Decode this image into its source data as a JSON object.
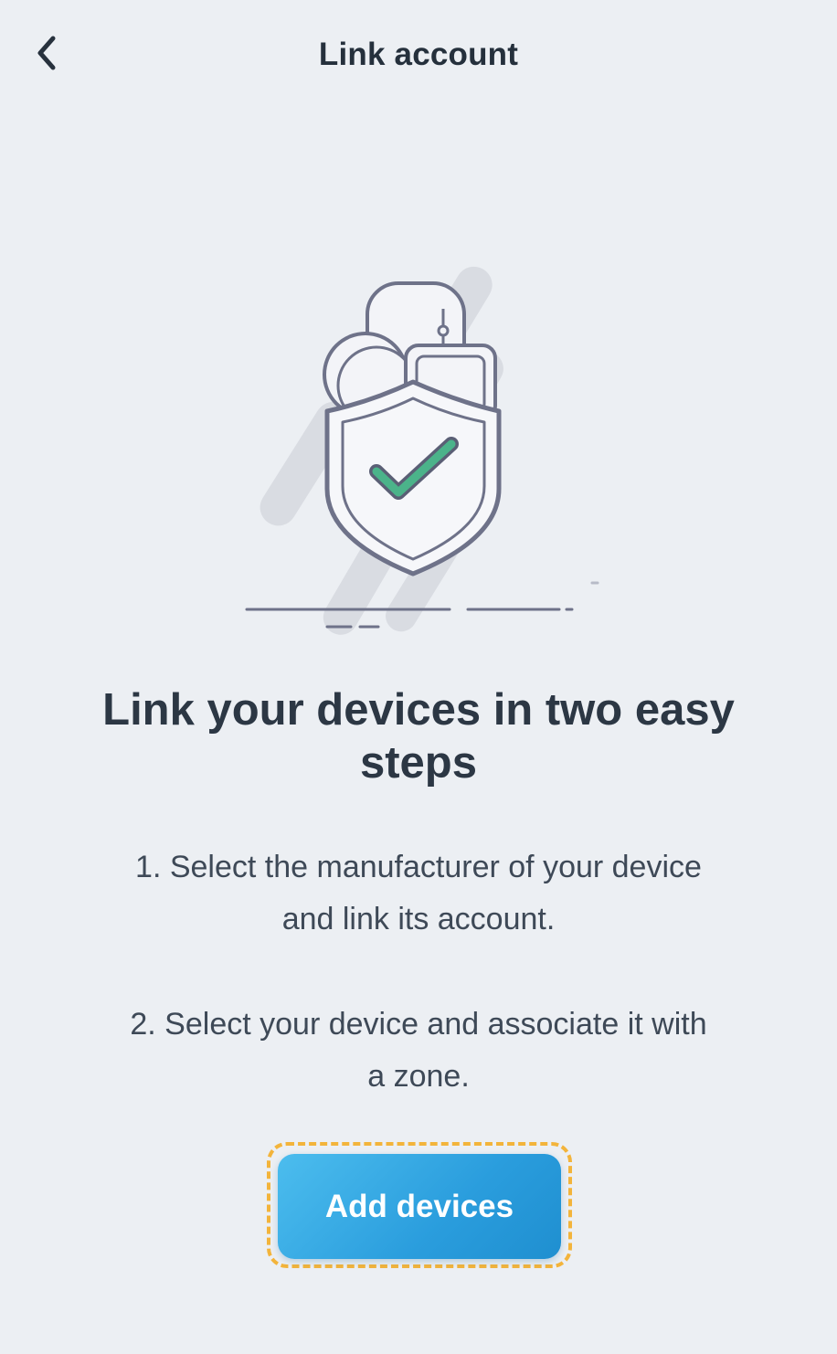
{
  "header": {
    "title": "Link account",
    "back_icon": "chevron-left-icon"
  },
  "illustration": {
    "icon": "shield-check-icon",
    "colors": {
      "outline": "#6e7289",
      "check": "#4bb38a",
      "shadow": "#d8dbe1"
    }
  },
  "main": {
    "headline": "Link your devices in two easy steps",
    "step_1": "1. Select the manufacturer of your device and link its account.",
    "step_2": "2. Select your device and associate it with a zone."
  },
  "cta": {
    "label": "Add devices",
    "focus_color": "#f3b43b",
    "button_color": "#2a9ddd"
  }
}
